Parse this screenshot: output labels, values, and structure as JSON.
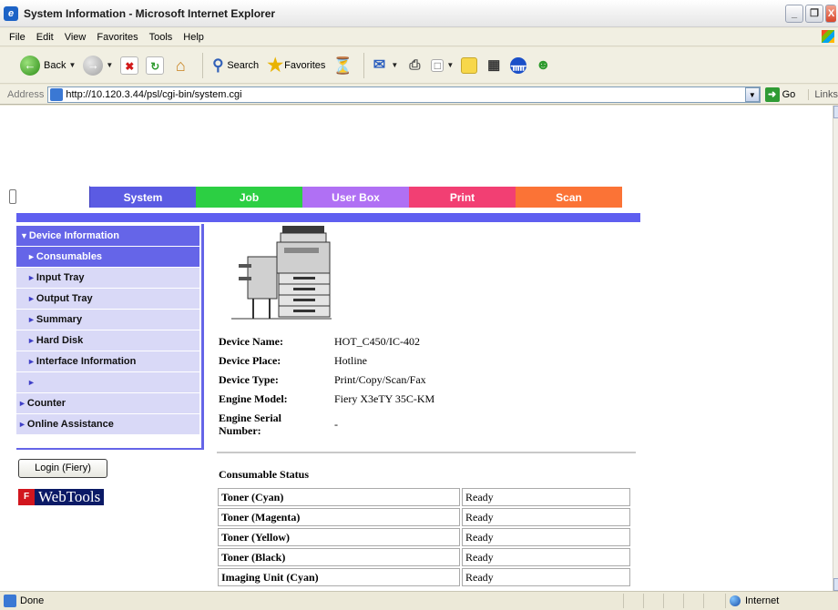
{
  "window": {
    "title": "System Information - Microsoft Internet Explorer",
    "controls": [
      "_",
      "❐",
      "X"
    ]
  },
  "menu": [
    "File",
    "Edit",
    "View",
    "Favorites",
    "Tools",
    "Help"
  ],
  "toolbar": {
    "back_label": "Back",
    "search_label": "Search",
    "favorites_label": "Favorites"
  },
  "address": {
    "label": "Address",
    "url": "http://10.120.3.44/psl/cgi-bin/system.cgi",
    "go_label": "Go",
    "links_label": "Links"
  },
  "tabs": [
    "System",
    "Job",
    "User Box",
    "Print",
    "Scan"
  ],
  "colors": {
    "system": "#5b5be3",
    "job": "#2ccf43",
    "userbox": "#b070f4",
    "print": "#f23f73",
    "scan": "#fb7336",
    "nav_active": "#6565e8"
  },
  "nav": {
    "device_information": "Device Information",
    "items": [
      "Consumables",
      "Input Tray",
      "Output Tray",
      "Summary",
      "Hard Disk",
      "Interface Information",
      ""
    ],
    "counter": "Counter",
    "online_assistance": "Online Assistance"
  },
  "login_button": "Login (Fiery)",
  "webtools": {
    "logo_text": "WebTools"
  },
  "device": {
    "rows": [
      {
        "key": "Device Name:",
        "value": "HOT_C450/IC-402"
      },
      {
        "key": "Device Place:",
        "value": "Hotline"
      },
      {
        "key": "Device Type:",
        "value": " Print/Copy/Scan/Fax"
      },
      {
        "key": "Engine Model:",
        "value": "Fiery X3eTY 35C-KM"
      },
      {
        "key": "Engine Serial Number:",
        "value": "-"
      }
    ]
  },
  "consumables": {
    "title": "Consumable Status",
    "rows": [
      {
        "item": "Toner (Cyan)",
        "status": "Ready"
      },
      {
        "item": "Toner (Magenta)",
        "status": "Ready"
      },
      {
        "item": "Toner (Yellow)",
        "status": "Ready"
      },
      {
        "item": "Toner (Black)",
        "status": "Ready"
      },
      {
        "item": "Imaging Unit (Cyan)",
        "status": "Ready"
      }
    ]
  },
  "status": {
    "text": "Done",
    "zone": "Internet"
  }
}
